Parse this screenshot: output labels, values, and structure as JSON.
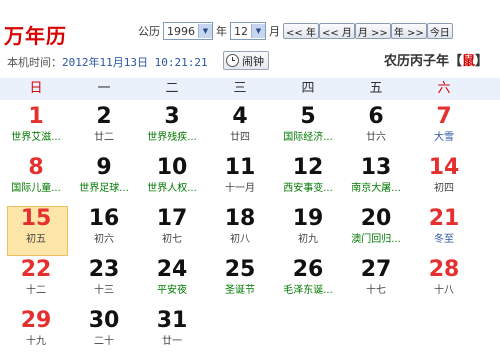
{
  "brand": "万年历",
  "nav": {
    "era_label": "公历",
    "year_value": "1996",
    "year_unit": "年",
    "month_value": "12",
    "month_unit": "月",
    "prev_year": "<< 年",
    "prev_month": "<< 月",
    "next_month": "月 >>",
    "next_year": "年 >>",
    "today": "今日"
  },
  "clock": {
    "label": "本机时间：",
    "value": "2012年11月13日 10:21:21"
  },
  "alarm_label": "闹钟",
  "lunar": {
    "prefix": "农历丙子年【",
    "zodiac": "鼠",
    "suffix": "】"
  },
  "weekdays": [
    "日",
    "一",
    "二",
    "三",
    "四",
    "五",
    "六"
  ],
  "days": [
    {
      "n": "1",
      "sub": "世界艾滋...",
      "kind": "fest"
    },
    {
      "n": "2",
      "sub": "廿二",
      "kind": ""
    },
    {
      "n": "3",
      "sub": "世界残疾...",
      "kind": "fest"
    },
    {
      "n": "4",
      "sub": "廿四",
      "kind": ""
    },
    {
      "n": "5",
      "sub": "国际经济...",
      "kind": "fest"
    },
    {
      "n": "6",
      "sub": "廿六",
      "kind": ""
    },
    {
      "n": "7",
      "sub": "大雪",
      "kind": "term"
    },
    {
      "n": "8",
      "sub": "国际儿童...",
      "kind": "fest"
    },
    {
      "n": "9",
      "sub": "世界足球...",
      "kind": "fest"
    },
    {
      "n": "10",
      "sub": "世界人权...",
      "kind": "fest"
    },
    {
      "n": "11",
      "sub": "十一月",
      "kind": ""
    },
    {
      "n": "12",
      "sub": "西安事变...",
      "kind": "fest"
    },
    {
      "n": "13",
      "sub": "南京大屠...",
      "kind": "fest"
    },
    {
      "n": "14",
      "sub": "初四",
      "kind": ""
    },
    {
      "n": "15",
      "sub": "初五",
      "kind": "",
      "today": true
    },
    {
      "n": "16",
      "sub": "初六",
      "kind": ""
    },
    {
      "n": "17",
      "sub": "初七",
      "kind": ""
    },
    {
      "n": "18",
      "sub": "初八",
      "kind": ""
    },
    {
      "n": "19",
      "sub": "初九",
      "kind": ""
    },
    {
      "n": "20",
      "sub": "澳门回归...",
      "kind": "fest"
    },
    {
      "n": "21",
      "sub": "冬至",
      "kind": "term"
    },
    {
      "n": "22",
      "sub": "十二",
      "kind": ""
    },
    {
      "n": "23",
      "sub": "十三",
      "kind": ""
    },
    {
      "n": "24",
      "sub": "平安夜",
      "kind": "fest"
    },
    {
      "n": "25",
      "sub": "圣诞节",
      "kind": "fest"
    },
    {
      "n": "26",
      "sub": "毛泽东诞...",
      "kind": "fest"
    },
    {
      "n": "27",
      "sub": "十七",
      "kind": ""
    },
    {
      "n": "28",
      "sub": "十八",
      "kind": ""
    },
    {
      "n": "29",
      "sub": "十九",
      "kind": ""
    },
    {
      "n": "30",
      "sub": "二十",
      "kind": ""
    },
    {
      "n": "31",
      "sub": "廿一",
      "kind": ""
    }
  ],
  "colors": {
    "weekend": "#e53030",
    "festival": "#007a00",
    "solar_term": "#2b56a6",
    "today_bg": "#fde6a8",
    "header_bg": "#eaf1fb",
    "brand": "#d80000"
  }
}
